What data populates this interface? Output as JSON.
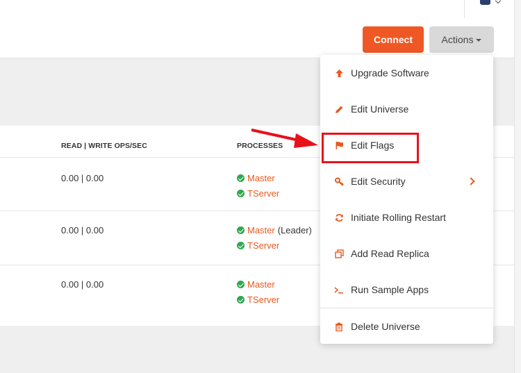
{
  "header": {
    "connect_label": "Connect",
    "actions_label": "Actions"
  },
  "table": {
    "columns": {
      "ops": "READ | WRITE OPS/SEC",
      "processes": "PROCESSES"
    },
    "rows": [
      {
        "ops": "0.00 | 0.00",
        "processes": [
          {
            "name": "Master",
            "note": ""
          },
          {
            "name": "TServer",
            "note": ""
          }
        ]
      },
      {
        "ops": "0.00 | 0.00",
        "processes": [
          {
            "name": "Master",
            "note": "(Leader)"
          },
          {
            "name": "TServer",
            "note": ""
          }
        ]
      },
      {
        "ops": "0.00 | 0.00",
        "processes": [
          {
            "name": "Master",
            "note": ""
          },
          {
            "name": "TServer",
            "note": ""
          }
        ]
      }
    ]
  },
  "actions_menu": {
    "items": [
      {
        "label": "Upgrade Software",
        "icon": "arrow-up-icon"
      },
      {
        "label": "Edit Universe",
        "icon": "pencil-icon"
      },
      {
        "label": "Edit Flags",
        "icon": "flag-icon"
      },
      {
        "label": "Edit Security",
        "icon": "key-icon"
      },
      {
        "label": "Initiate Rolling Restart",
        "icon": "refresh-icon"
      },
      {
        "label": "Add Read Replica",
        "icon": "copy-icon"
      },
      {
        "label": "Run Sample Apps",
        "icon": "terminal-icon"
      },
      {
        "label": "Delete Universe",
        "icon": "trash-icon"
      }
    ]
  },
  "colors": {
    "accent": "#ef5824",
    "highlight": "#e8101a",
    "success": "#2fa84f"
  }
}
